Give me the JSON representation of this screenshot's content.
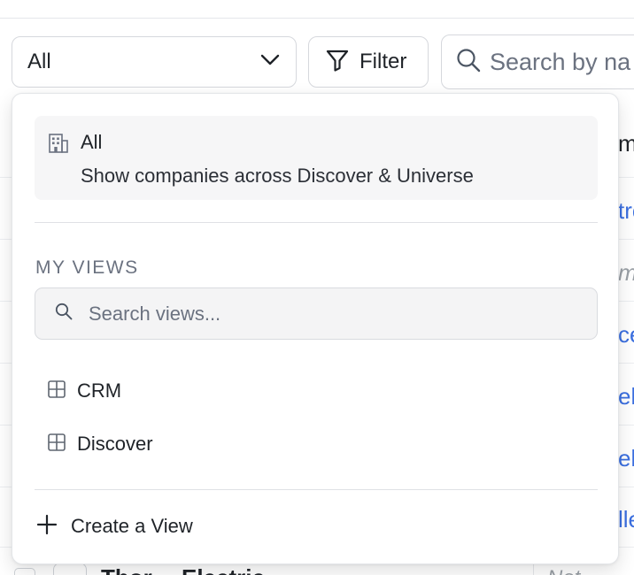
{
  "toolbar": {
    "view_select_value": "All",
    "filter_label": "Filter",
    "search_placeholder": "Search by na"
  },
  "background_table": {
    "header_fragment": "m",
    "cells": [
      {
        "text": "tro",
        "style": "link"
      },
      {
        "text": "m",
        "style": "italic"
      },
      {
        "text": "ce",
        "style": "link"
      },
      {
        "text": "ele",
        "style": "link"
      },
      {
        "text": "ele",
        "style": "link"
      },
      {
        "text": "lle",
        "style": "link"
      }
    ],
    "bottom_row": {
      "name": "Thor… Electric",
      "value": "Not"
    }
  },
  "dropdown": {
    "all_option": {
      "title": "All",
      "description": "Show companies across Discover & Universe",
      "icon": "building-icon"
    },
    "my_views": {
      "section_label": "MY VIEWS",
      "search_placeholder": "Search views...",
      "items": [
        {
          "label": "CRM",
          "icon": "table-grid-icon"
        },
        {
          "label": "Discover",
          "icon": "table-grid-icon"
        }
      ]
    },
    "create_view_label": "Create a View"
  },
  "colors": {
    "link": "#3b6fe0",
    "muted_text": "#6b7280",
    "selected_bg": "#f6f6f7",
    "border": "#d6d8dd"
  }
}
